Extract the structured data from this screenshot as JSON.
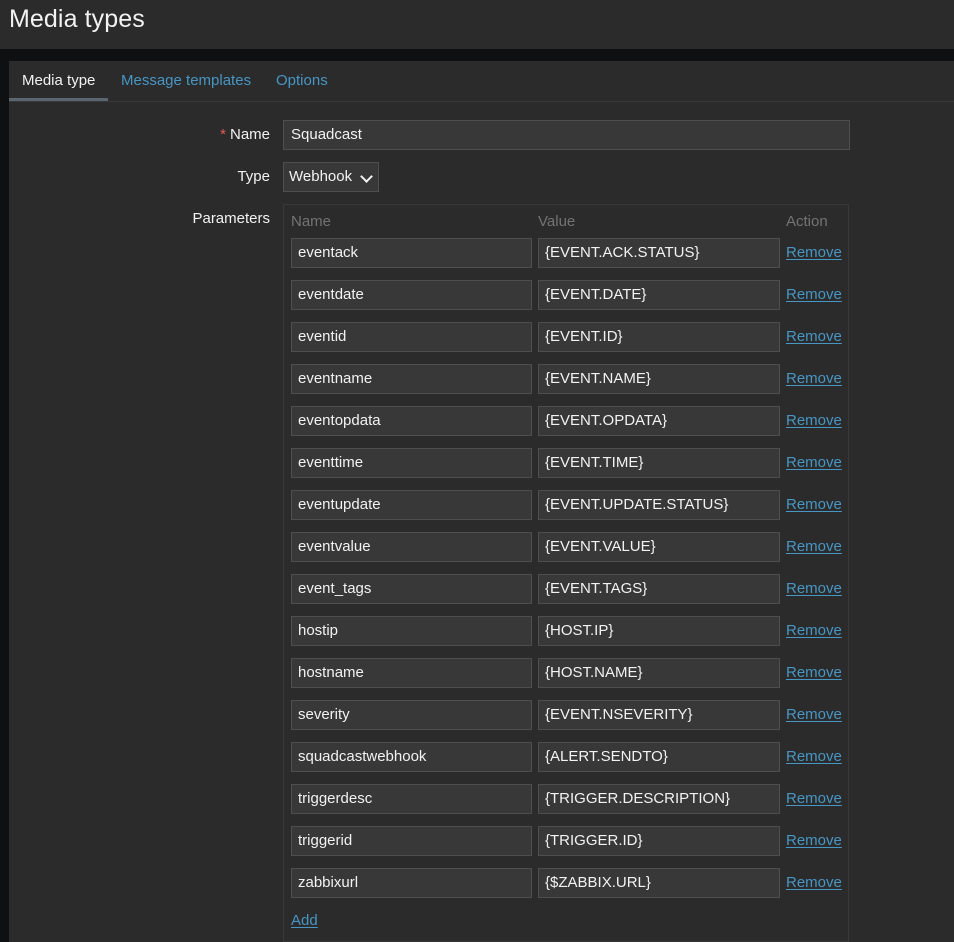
{
  "page": {
    "title": "Media types"
  },
  "tabs": [
    {
      "label": "Media type",
      "active": true
    },
    {
      "label": "Message templates",
      "active": false
    },
    {
      "label": "Options",
      "active": false
    }
  ],
  "form": {
    "name_label": "Name",
    "required_marker": "*",
    "name_value": "Squadcast",
    "type_label": "Type",
    "type_value": "Webhook",
    "parameters_label": "Parameters"
  },
  "parameters": {
    "headers": {
      "name": "Name",
      "value": "Value",
      "action": "Action"
    },
    "rows": [
      {
        "name": "eventack",
        "value": "{EVENT.ACK.STATUS}",
        "action": "Remove"
      },
      {
        "name": "eventdate",
        "value": "{EVENT.DATE}",
        "action": "Remove"
      },
      {
        "name": "eventid",
        "value": "{EVENT.ID}",
        "action": "Remove"
      },
      {
        "name": "eventname",
        "value": "{EVENT.NAME}",
        "action": "Remove"
      },
      {
        "name": "eventopdata",
        "value": "{EVENT.OPDATA}",
        "action": "Remove"
      },
      {
        "name": "eventtime",
        "value": "{EVENT.TIME}",
        "action": "Remove"
      },
      {
        "name": "eventupdate",
        "value": "{EVENT.UPDATE.STATUS}",
        "action": "Remove"
      },
      {
        "name": "eventvalue",
        "value": "{EVENT.VALUE}",
        "action": "Remove"
      },
      {
        "name": "event_tags",
        "value": "{EVENT.TAGS}",
        "action": "Remove"
      },
      {
        "name": "hostip",
        "value": "{HOST.IP}",
        "action": "Remove"
      },
      {
        "name": "hostname",
        "value": "{HOST.NAME}",
        "action": "Remove"
      },
      {
        "name": "severity",
        "value": "{EVENT.NSEVERITY}",
        "action": "Remove"
      },
      {
        "name": "squadcastwebhook",
        "value": "{ALERT.SENDTO}",
        "action": "Remove"
      },
      {
        "name": "triggerdesc",
        "value": "{TRIGGER.DESCRIPTION}",
        "action": "Remove"
      },
      {
        "name": "triggerid",
        "value": "{TRIGGER.ID}",
        "action": "Remove"
      },
      {
        "name": "zabbixurl",
        "value": "{$ZABBIX.URL}",
        "action": "Remove"
      }
    ],
    "add_label": "Add"
  },
  "colors": {
    "background": "#0e1012",
    "panel": "#2b2b2b",
    "input": "#383838",
    "link": "#4796c4",
    "required": "#e45959",
    "muted": "#737373"
  }
}
